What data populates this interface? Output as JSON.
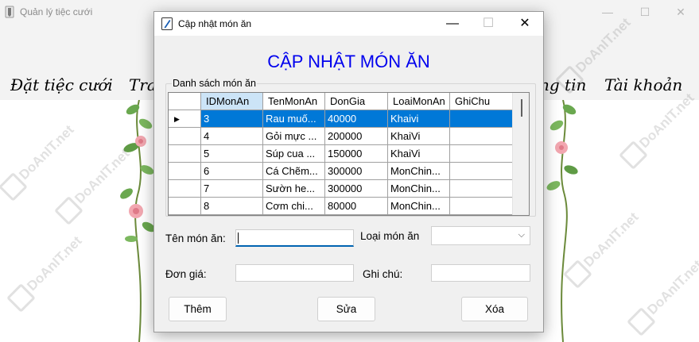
{
  "main_window": {
    "title": "Quản lý tiệc cưới",
    "controls": {
      "minimize": "—",
      "maximize": "☐",
      "close": "✕"
    },
    "menu": [
      "Đặt tiệc cưới",
      "Tra",
      "ng tin",
      "Tài khoản"
    ]
  },
  "dialog": {
    "title": "Cập nhật món ăn",
    "controls": {
      "minimize": "—",
      "maximize": "☐",
      "close": "✕"
    },
    "heading": "CẬP NHẬT MÓN ĂN",
    "group_label": "Danh sách món ăn",
    "grid": {
      "columns": [
        "IDMonAn",
        "TenMonAn",
        "DonGia",
        "LoaiMonAn",
        "GhiChu"
      ],
      "rows": [
        [
          "3",
          "Rau muố...",
          "40000",
          "Khaivi",
          ""
        ],
        [
          "4",
          "Gỏi mực ...",
          "200000",
          "KhaiVi",
          ""
        ],
        [
          "5",
          "Súp cua ...",
          "150000",
          "KhaiVi",
          ""
        ],
        [
          "6",
          "Cá Chẽm...",
          "300000",
          "MonChin...",
          ""
        ],
        [
          "7",
          "Sườn he...",
          "300000",
          "MonChin...",
          ""
        ],
        [
          "8",
          "Cơm chi...",
          "80000",
          "MonChin...",
          ""
        ]
      ],
      "selected_row": 0,
      "row_indicator": "▶"
    },
    "form": {
      "ten_mon_an_label": "Tên món ăn:",
      "ten_mon_an_value": "",
      "loai_mon_an_label": "Loại món ăn",
      "loai_mon_an_value": "",
      "don_gia_label": "Đơn giá:",
      "don_gia_value": "",
      "ghi_chu_label": "Ghi chú:",
      "ghi_chu_value": ""
    },
    "buttons": {
      "add": "Thêm",
      "update": "Sửa",
      "delete": "Xóa"
    }
  },
  "watermark": "DoAnIT.net",
  "colors": {
    "heading": "#0000ee",
    "selection": "#0078d7",
    "header_active": "#cce4f7"
  }
}
